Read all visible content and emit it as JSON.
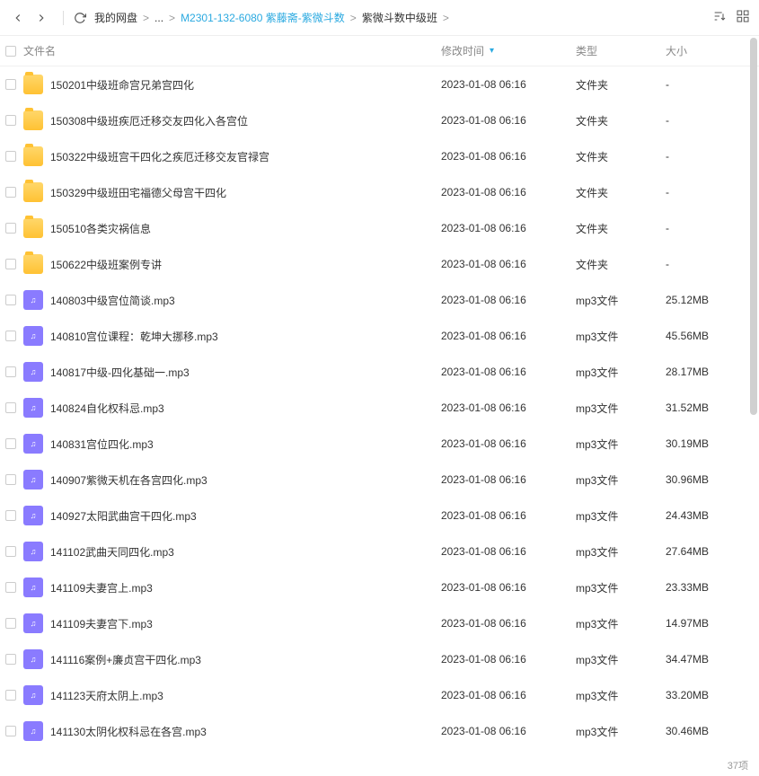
{
  "toolbar": {
    "crumbs": [
      {
        "label": "我的网盘",
        "active": false
      },
      {
        "label": "...",
        "active": false
      },
      {
        "label": "M2301-132-6080 紫藤斋-紫微斗数",
        "active": true
      },
      {
        "label": "紫微斗数中级班",
        "active": false
      }
    ]
  },
  "columns": {
    "name": "文件名",
    "time": "修改时间",
    "type": "类型",
    "size": "大小"
  },
  "files": [
    {
      "icon": "folder",
      "name": "150201中级班命宫兄弟宫四化",
      "time": "2023-01-08 06:16",
      "type": "文件夹",
      "size": "-"
    },
    {
      "icon": "folder",
      "name": "150308中级班疾厄迁移交友四化入各宫位",
      "time": "2023-01-08 06:16",
      "type": "文件夹",
      "size": "-"
    },
    {
      "icon": "folder",
      "name": "150322中级班宫干四化之疾厄迁移交友官禄宫",
      "time": "2023-01-08 06:16",
      "type": "文件夹",
      "size": "-"
    },
    {
      "icon": "folder",
      "name": "150329中级班田宅福德父母宫干四化",
      "time": "2023-01-08 06:16",
      "type": "文件夹",
      "size": "-"
    },
    {
      "icon": "folder",
      "name": "150510各类灾祸信息",
      "time": "2023-01-08 06:16",
      "type": "文件夹",
      "size": "-"
    },
    {
      "icon": "folder",
      "name": "150622中级班案例专讲",
      "time": "2023-01-08 06:16",
      "type": "文件夹",
      "size": "-"
    },
    {
      "icon": "mp3",
      "name": "140803中级宫位简谈.mp3",
      "time": "2023-01-08 06:16",
      "type": "mp3文件",
      "size": "25.12MB"
    },
    {
      "icon": "mp3",
      "name": "140810宫位课程：乾坤大挪移.mp3",
      "time": "2023-01-08 06:16",
      "type": "mp3文件",
      "size": "45.56MB"
    },
    {
      "icon": "mp3",
      "name": "140817中级-四化基础一.mp3",
      "time": "2023-01-08 06:16",
      "type": "mp3文件",
      "size": "28.17MB"
    },
    {
      "icon": "mp3",
      "name": "140824自化权科忌.mp3",
      "time": "2023-01-08 06:16",
      "type": "mp3文件",
      "size": "31.52MB"
    },
    {
      "icon": "mp3",
      "name": "140831宫位四化.mp3",
      "time": "2023-01-08 06:16",
      "type": "mp3文件",
      "size": "30.19MB"
    },
    {
      "icon": "mp3",
      "name": "140907紫微天机在各宫四化.mp3",
      "time": "2023-01-08 06:16",
      "type": "mp3文件",
      "size": "30.96MB"
    },
    {
      "icon": "mp3",
      "name": "140927太阳武曲宫干四化.mp3",
      "time": "2023-01-08 06:16",
      "type": "mp3文件",
      "size": "24.43MB"
    },
    {
      "icon": "mp3",
      "name": "141102武曲天同四化.mp3",
      "time": "2023-01-08 06:16",
      "type": "mp3文件",
      "size": "27.64MB"
    },
    {
      "icon": "mp3",
      "name": "141109夫妻宫上.mp3",
      "time": "2023-01-08 06:16",
      "type": "mp3文件",
      "size": "23.33MB"
    },
    {
      "icon": "mp3",
      "name": "141109夫妻宫下.mp3",
      "time": "2023-01-08 06:16",
      "type": "mp3文件",
      "size": "14.97MB"
    },
    {
      "icon": "mp3",
      "name": "141116案例+廉贞宫干四化.mp3",
      "time": "2023-01-08 06:16",
      "type": "mp3文件",
      "size": "34.47MB"
    },
    {
      "icon": "mp3",
      "name": "141123天府太阴上.mp3",
      "time": "2023-01-08 06:16",
      "type": "mp3文件",
      "size": "33.20MB"
    },
    {
      "icon": "mp3",
      "name": "141130太阴化权科忌在各宫.mp3",
      "time": "2023-01-08 06:16",
      "type": "mp3文件",
      "size": "30.46MB"
    }
  ],
  "footer": "37项"
}
